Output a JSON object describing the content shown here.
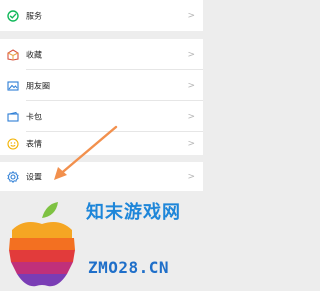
{
  "menu": {
    "services_label": "服务",
    "favorites_label": "收藏",
    "moments_label": "朋友圈",
    "cards_label": "卡包",
    "stickers_label": "表情",
    "settings_label": "设置",
    "chevron": ">"
  },
  "watermark": {
    "title": "知末游戏网",
    "url": "ZMO28.CN"
  },
  "colors": {
    "services_icon": "#11b85a",
    "favorites_icon": "#d8523f",
    "moments_icon": "#2f7fd6",
    "cards_icon": "#2f7fd6",
    "stickers_icon": "#f2b200",
    "settings_icon": "#2f7fd6",
    "arrow": "#f2904d"
  }
}
